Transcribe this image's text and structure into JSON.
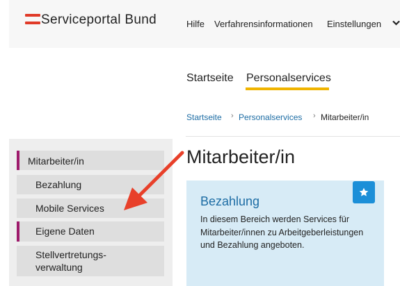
{
  "header": {
    "brand": "Serviceportal Bund",
    "nav": {
      "help": "Hilfe",
      "procedures": "Verfahrensinformationen",
      "settings": "Einstellungen"
    },
    "accent_color": "#e03a28"
  },
  "tabs": {
    "home": "Startseite",
    "personal": "Personalservices",
    "active_underline_color": "#f0b400"
  },
  "breadcrumb": {
    "home": "Startseite",
    "personal": "Personalservices",
    "current": "Mitarbeiter/in",
    "separator": "›"
  },
  "sidebar": {
    "items": [
      {
        "label": "Mitarbeiter/in",
        "active": true
      },
      {
        "label": "Bezahlung"
      },
      {
        "label": "Mobile Services"
      },
      {
        "label": "Eigene Daten",
        "active": true
      },
      {
        "label": "Stellvertretungs-verwaltung",
        "line1": "Stellvertretungs-",
        "line2": "verwaltung"
      }
    ],
    "accent_color": "#9e1b6c"
  },
  "main": {
    "title": "Mitarbeiter/in",
    "card": {
      "title": "Bezahlung",
      "text": "In diesem Bereich werden Services für Mitarbeiter/innen zu Arbeitgeberleistungen und Bezahlung angeboten.",
      "favorite_icon": "star-icon",
      "background": "#d7ebf6"
    }
  },
  "annotation": {
    "arrow_color": "#e8402a"
  }
}
